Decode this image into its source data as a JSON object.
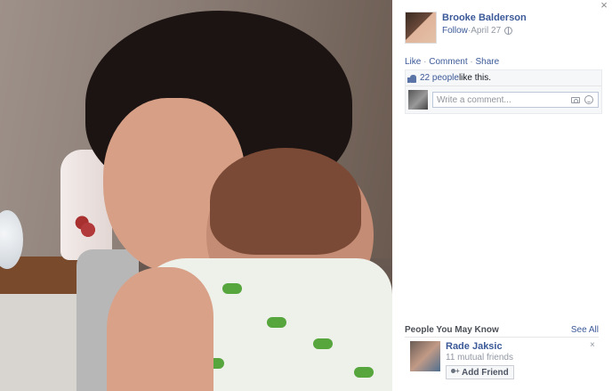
{
  "post": {
    "author_name": "Brooke Balderson",
    "follow_label": "Follow",
    "separator": " · ",
    "date": "April 27",
    "privacy_icon": "globe-icon"
  },
  "actions": {
    "like": "Like",
    "comment": "Comment",
    "share": "Share",
    "separator": " · "
  },
  "likes": {
    "count_text": "22 people",
    "suffix": " like this."
  },
  "comment_box": {
    "placeholder": "Write a comment...",
    "camera_icon": "camera-icon",
    "emoji_icon": "smiley-icon"
  },
  "close_icon": "×",
  "pymk": {
    "title": "People You May Know",
    "see_all": "See All",
    "person": {
      "name": "Rade Jaksic",
      "mutual": "11 mutual friends",
      "add_label": "Add Friend"
    },
    "dismiss": "×"
  }
}
